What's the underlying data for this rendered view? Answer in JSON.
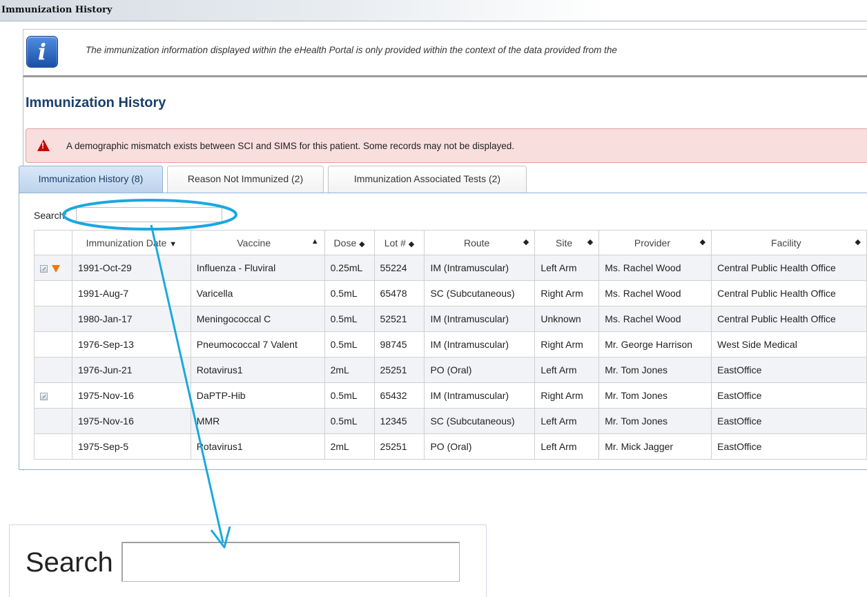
{
  "window": {
    "title": "Immunization History"
  },
  "info": {
    "icon": "info-icon",
    "glyph": "i",
    "text": "The immunization information displayed within the eHealth Portal is only provided within the context of the data provided from the"
  },
  "page": {
    "title": "Immunization History"
  },
  "alert": {
    "icon": "warning-icon",
    "text": "A demographic mismatch exists between SCI and SIMS for this patient. Some records may not be displayed."
  },
  "tabs": [
    {
      "label": "Immunization History (8)",
      "active": true
    },
    {
      "label": "Reason Not Immunized (2)",
      "active": false
    },
    {
      "label": "Immunization Associated Tests (2)",
      "active": false
    }
  ],
  "search": {
    "label": "Search:",
    "value": ""
  },
  "table": {
    "columns": [
      {
        "label": "Immunization Date",
        "sort": "▼"
      },
      {
        "label": "Vaccine",
        "sort": "▲"
      },
      {
        "label": "Dose",
        "sort": "◆"
      },
      {
        "label": "Lot #",
        "sort": "◆"
      },
      {
        "label": "Route",
        "sort": "◆"
      },
      {
        "label": "Site",
        "sort": "◆"
      },
      {
        "label": "Provider",
        "sort": "◆"
      },
      {
        "label": "Facility",
        "sort": "◆"
      }
    ],
    "rows": [
      {
        "date": "1991-Oct-29",
        "vaccine": "Influenza - Fluviral",
        "dose": "0.25mL",
        "lot": "55224",
        "route": "IM (Intramuscular)",
        "site": "Left Arm",
        "provider": "Ms. Rachel Wood",
        "facility": "Central Public Health Office",
        "edit": true,
        "flag": true
      },
      {
        "date": "1991-Aug-7",
        "vaccine": "Varicella",
        "dose": "0.5mL",
        "lot": "65478",
        "route": "SC (Subcutaneous)",
        "site": "Right Arm",
        "provider": "Ms. Rachel Wood",
        "facility": "Central Public Health Office",
        "edit": false,
        "flag": false
      },
      {
        "date": "1980-Jan-17",
        "vaccine": "Meningococcal C",
        "dose": "0.5mL",
        "lot": "52521",
        "route": "IM (Intramuscular)",
        "site": "Unknown",
        "provider": "Ms. Rachel Wood",
        "facility": "Central Public Health Office",
        "edit": false,
        "flag": false
      },
      {
        "date": "1976-Sep-13",
        "vaccine": "Pneumococcal 7 Valent",
        "dose": "0.5mL",
        "lot": "98745",
        "route": "IM (Intramuscular)",
        "site": "Right Arm",
        "provider": "Mr. George Harrison",
        "facility": "West Side Medical",
        "edit": false,
        "flag": false
      },
      {
        "date": "1976-Jun-21",
        "vaccine": "Rotavirus1",
        "dose": "2mL",
        "lot": "25251",
        "route": "PO (Oral)",
        "site": "Left Arm",
        "provider": "Mr. Tom Jones",
        "facility": "EastOffice",
        "edit": false,
        "flag": false
      },
      {
        "date": "1975-Nov-16",
        "vaccine": "DaPTP-Hib",
        "dose": "0.5mL",
        "lot": "65432",
        "route": "IM (Intramuscular)",
        "site": "Right Arm",
        "provider": "Mr. Tom Jones",
        "facility": "EastOffice",
        "edit": true,
        "flag": false
      },
      {
        "date": "1975-Nov-16",
        "vaccine": "MMR",
        "dose": "0.5mL",
        "lot": "12345",
        "route": "SC (Subcutaneous)",
        "site": "Left Arm",
        "provider": "Mr. Tom Jones",
        "facility": "EastOffice",
        "edit": false,
        "flag": false
      },
      {
        "date": "1975-Sep-5",
        "vaccine": "Rotavirus1",
        "dose": "2mL",
        "lot": "25251",
        "route": "PO (Oral)",
        "site": "Left Arm",
        "provider": "Mr. Mick Jagger",
        "facility": "EastOffice",
        "edit": false,
        "flag": false
      }
    ]
  },
  "zoom_callout": {
    "label": "Search",
    "value": ""
  },
  "colors": {
    "accent": "#1a3f6b",
    "highlight": "#1aa8e0",
    "alert_bg": "#f9dede",
    "alert_icon": "#c80000",
    "flag": "#f07800"
  }
}
